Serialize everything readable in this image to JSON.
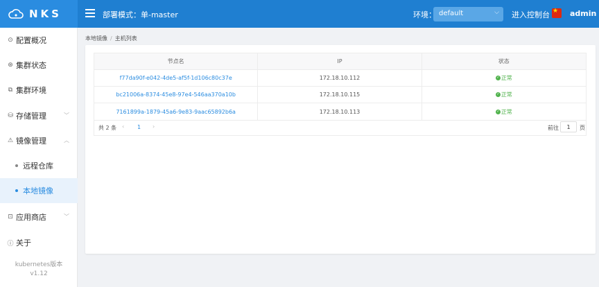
{
  "header": {
    "logo_text": "NKS",
    "mode_label": "部署模式：单-master",
    "env_label": "环境：",
    "env_value": "default",
    "console_link": "进入控制台",
    "username": "admin"
  },
  "sidebar": {
    "items": [
      {
        "label": "配置概况",
        "icon": "info-circle-icon"
      },
      {
        "label": "集群状态",
        "icon": "cluster-icon"
      },
      {
        "label": "集群环境",
        "icon": "environment-icon"
      },
      {
        "label": "存储管理",
        "icon": "storage-icon"
      },
      {
        "label": "镜像管理",
        "icon": "warning-triangle-icon"
      },
      {
        "label": "应用商店",
        "icon": "shop-icon"
      },
      {
        "label": "关于",
        "icon": "about-icon"
      }
    ],
    "sub_items": [
      {
        "label": "远程仓库"
      },
      {
        "label": "本地镜像"
      }
    ],
    "version_label": "kubernetes版本",
    "version_value": "v1.12"
  },
  "breadcrumb": {
    "items": [
      "本地镜像",
      "主机列表"
    ]
  },
  "table": {
    "columns": [
      "节点名",
      "IP",
      "状态"
    ],
    "rows": [
      {
        "name": "f77da90f-e042-4de5-af5f-1d106c80c37e",
        "ip": "172.18.10.112",
        "status": "正常"
      },
      {
        "name": "bc21006a-8374-45e8-97e4-546aa370a10b",
        "ip": "172.18.10.115",
        "status": "正常"
      },
      {
        "name": "7161899a-1879-45a6-9e83-9aac65892b6a",
        "ip": "172.18.10.113",
        "status": "正常"
      }
    ]
  },
  "pagination": {
    "total": "共 2 条",
    "current_page": "1",
    "goto_label": "前往",
    "goto_value": "1",
    "goto_unit": "页"
  },
  "colors": {
    "primary": "#1f7fd1",
    "accent": "#2a8ce0",
    "success": "#52b34e"
  }
}
